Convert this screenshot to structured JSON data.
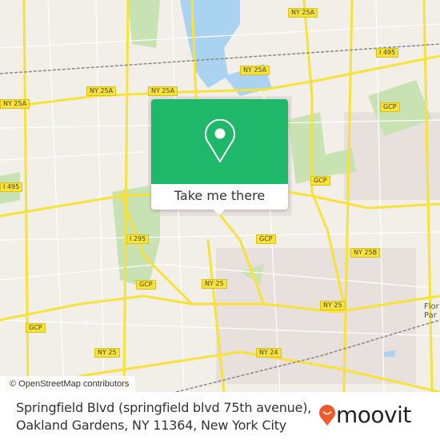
{
  "map": {
    "road_labels": [
      {
        "label": "NY 25A",
        "pos": "top-center"
      },
      {
        "label": "I 495",
        "pos": "top-right"
      },
      {
        "label": "NY 25A",
        "pos": "upper-left-edge"
      },
      {
        "label": "NY 25A",
        "pos": "upper-left"
      },
      {
        "label": "NY 25A",
        "pos": "upper-center"
      },
      {
        "label": "NY 25A",
        "pos": "upper-center-right"
      },
      {
        "label": "GCP",
        "pos": "right-upper"
      },
      {
        "label": "GCP",
        "pos": "center-right"
      },
      {
        "label": "I 495",
        "pos": "left"
      },
      {
        "label": "I 295",
        "pos": "center-left"
      },
      {
        "label": "GCP",
        "pos": "center"
      },
      {
        "label": "NY 25B",
        "pos": "right"
      },
      {
        "label": "GCP",
        "pos": "lower-left"
      },
      {
        "label": "NY 25",
        "pos": "lower-center"
      },
      {
        "label": "NY 25",
        "pos": "lower-right"
      },
      {
        "label": "GCP",
        "pos": "bottom-left"
      },
      {
        "label": "NY 25",
        "pos": "bottom-left-center"
      },
      {
        "label": "NY 24",
        "pos": "bottom-center"
      }
    ],
    "place_label": "Flor Par",
    "attribution": "© OpenStreetMap contributors",
    "colors": {
      "water": "#a9d3f0",
      "park": "#c8e2b4",
      "road": "#f7e23a",
      "land": "#f2efe9",
      "urban": "#e8e0dc"
    }
  },
  "popup": {
    "icon": "map-pin-icon",
    "button_label": "Take me there",
    "color": "#1fb86a"
  },
  "footer": {
    "address_line1": "Springfield Blvd (springfield blvd 75th avenue),",
    "address_line2": "Oakland Gardens, NY 11364, New York City",
    "brand": "moovit",
    "brand_color": "#f1592a"
  }
}
